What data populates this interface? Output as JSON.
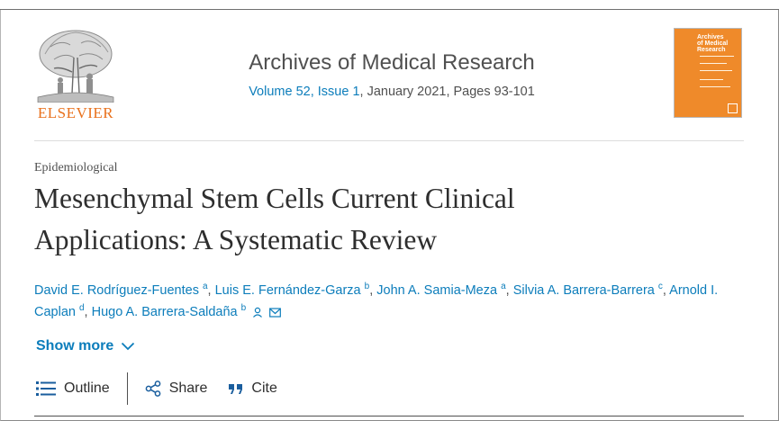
{
  "header": {
    "publisher_name": "ELSEVIER",
    "publisher_logo_icon": "elsevier-tree-logo",
    "journal_title": "Archives of Medical Research",
    "volume_issue": "Volume 52, Issue 1",
    "date_pages": ", January 2021, Pages 93-101",
    "cover": {
      "title_line1": "Archives",
      "title_line2": "of Medical",
      "title_line3": "Research",
      "color": "#ef8a2a"
    }
  },
  "article": {
    "category": "Epidemiological",
    "title_line1": "Mesenchymal Stem Cells Current Clinical",
    "title_line2": "Applications: A Systematic Review"
  },
  "authors": [
    {
      "name": "David E. Rodríguez-Fuentes",
      "sup": "a"
    },
    {
      "name": "Luis E. Fernández-Garza",
      "sup": "b"
    },
    {
      "name": "John A. Samia-Meza",
      "sup": "a"
    },
    {
      "name": "Silvia A. Barrera-Barrera",
      "sup": "c"
    },
    {
      "name": "Arnold I.",
      "sup": ""
    },
    {
      "name": "Caplan",
      "sup": "d"
    },
    {
      "name": "Hugo A. Barrera-Saldaña",
      "sup": "b"
    }
  ],
  "show_more_label": "Show more",
  "toolbar": {
    "outline_label": "Outline",
    "share_label": "Share",
    "cite_label": "Cite"
  },
  "colors": {
    "link": "#0c7dbb",
    "brand_orange": "#e9711c",
    "text": "#2e2e2e"
  }
}
